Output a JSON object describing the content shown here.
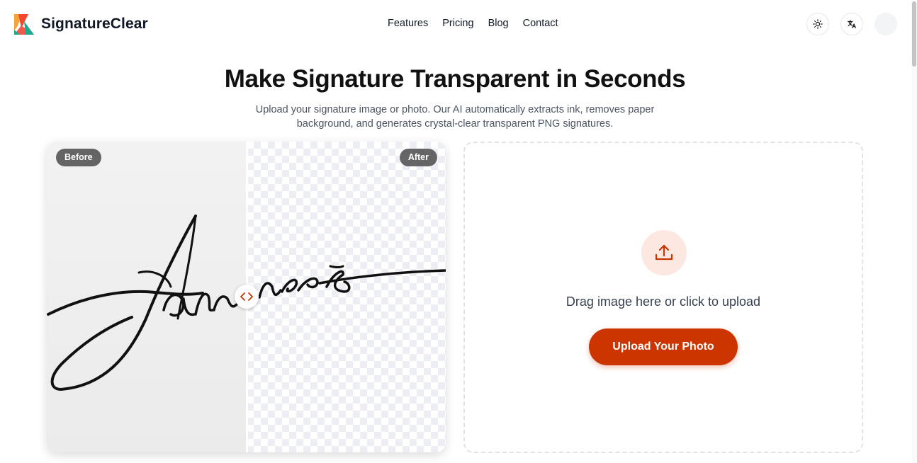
{
  "header": {
    "brand": "SignatureClear",
    "nav": [
      "Features",
      "Pricing",
      "Blog",
      "Contact"
    ],
    "theme_icon": "sun-icon",
    "language_icon": "translate-icon"
  },
  "hero": {
    "title": "Make Signature Transparent in Seconds",
    "subtitle": "Upload your signature image or photo. Our AI automatically extracts ink, removes paper background, and generates crystal-clear transparent PNG signatures."
  },
  "compare": {
    "before_label": "Before",
    "after_label": "After",
    "handle_icon": "code-arrows-icon"
  },
  "upload": {
    "prompt": "Drag image here or click to upload",
    "button_label": "Upload Your Photo",
    "icon": "upload-icon"
  },
  "colors": {
    "accent": "#cc3400",
    "accent_soft": "#fde8e1",
    "text": "#111827"
  }
}
